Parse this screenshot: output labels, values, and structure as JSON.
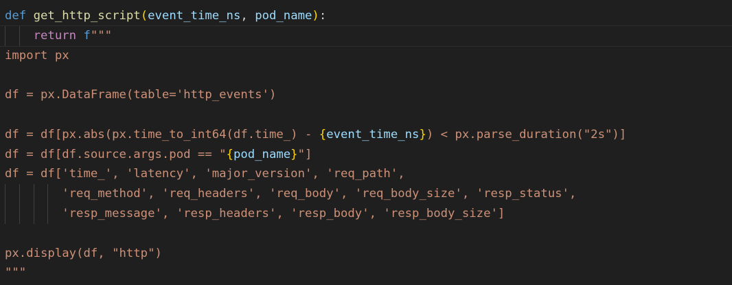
{
  "editor": {
    "theme": {
      "background": "#1f1f1f",
      "keyword": "#569cd6",
      "control_keyword": "#c586c0",
      "function": "#dcdcaa",
      "variable": "#9cdcfe",
      "string": "#ce9178",
      "brace": "#ffd700",
      "plain": "#d4d4d4"
    },
    "lines": [
      {
        "indent": 0,
        "current": false,
        "tokens": [
          {
            "t": "def",
            "c": "kw"
          },
          {
            "t": " ",
            "c": "pl"
          },
          {
            "t": "get_http_script",
            "c": "fn"
          },
          {
            "t": "(",
            "c": "brace"
          },
          {
            "t": "event_time_ns",
            "c": "var"
          },
          {
            "t": ", ",
            "c": "pl"
          },
          {
            "t": "pod_name",
            "c": "var"
          },
          {
            "t": ")",
            "c": "brace"
          },
          {
            "t": ":",
            "c": "pl"
          }
        ]
      },
      {
        "indent": 2,
        "current": true,
        "tokens": [
          {
            "t": "    ",
            "c": "pl"
          },
          {
            "t": "return",
            "c": "kwc"
          },
          {
            "t": " ",
            "c": "pl"
          },
          {
            "t": "f",
            "c": "prefix"
          },
          {
            "t": "\"\"\"",
            "c": "str"
          }
        ]
      },
      {
        "indent": 0,
        "current": false,
        "tokens": [
          {
            "t": "import px",
            "c": "str"
          }
        ]
      },
      {
        "indent": 0,
        "current": false,
        "tokens": [
          {
            "t": "",
            "c": "str"
          }
        ]
      },
      {
        "indent": 0,
        "current": false,
        "tokens": [
          {
            "t": "df = px.DataFrame(table='http_events')",
            "c": "str"
          }
        ]
      },
      {
        "indent": 0,
        "current": false,
        "tokens": [
          {
            "t": "",
            "c": "str"
          }
        ]
      },
      {
        "indent": 0,
        "current": false,
        "tokens": [
          {
            "t": "df = df[px.abs(px.time_to_int64(df.time_) - ",
            "c": "str"
          },
          {
            "t": "{",
            "c": "brace"
          },
          {
            "t": "event_time_ns",
            "c": "var"
          },
          {
            "t": "}",
            "c": "brace"
          },
          {
            "t": ") < px.parse_duration(\"2s\")]",
            "c": "str"
          }
        ]
      },
      {
        "indent": 0,
        "current": false,
        "tokens": [
          {
            "t": "df = df[df.source.args.pod == \"",
            "c": "str"
          },
          {
            "t": "{",
            "c": "brace"
          },
          {
            "t": "pod_name",
            "c": "var"
          },
          {
            "t": "}",
            "c": "brace"
          },
          {
            "t": "\"]",
            "c": "str"
          }
        ]
      },
      {
        "indent": 0,
        "current": false,
        "tokens": [
          {
            "t": "df = df['time_', 'latency', 'major_version', 'req_path',",
            "c": "str"
          }
        ]
      },
      {
        "indent": 4,
        "current": false,
        "tokens": [
          {
            "t": "        'req_method', 'req_headers', 'req_body', 'req_body_size', 'resp_status',",
            "c": "str"
          }
        ]
      },
      {
        "indent": 4,
        "current": false,
        "tokens": [
          {
            "t": "        'resp_message', 'resp_headers', 'resp_body', 'resp_body_size']",
            "c": "str"
          }
        ]
      },
      {
        "indent": 0,
        "current": false,
        "tokens": [
          {
            "t": "",
            "c": "str"
          }
        ]
      },
      {
        "indent": 0,
        "current": false,
        "tokens": [
          {
            "t": "px.display(df, \"http\")",
            "c": "str"
          }
        ]
      },
      {
        "indent": 0,
        "current": false,
        "tokens": [
          {
            "t": "\"\"\"",
            "c": "str"
          }
        ]
      }
    ]
  }
}
